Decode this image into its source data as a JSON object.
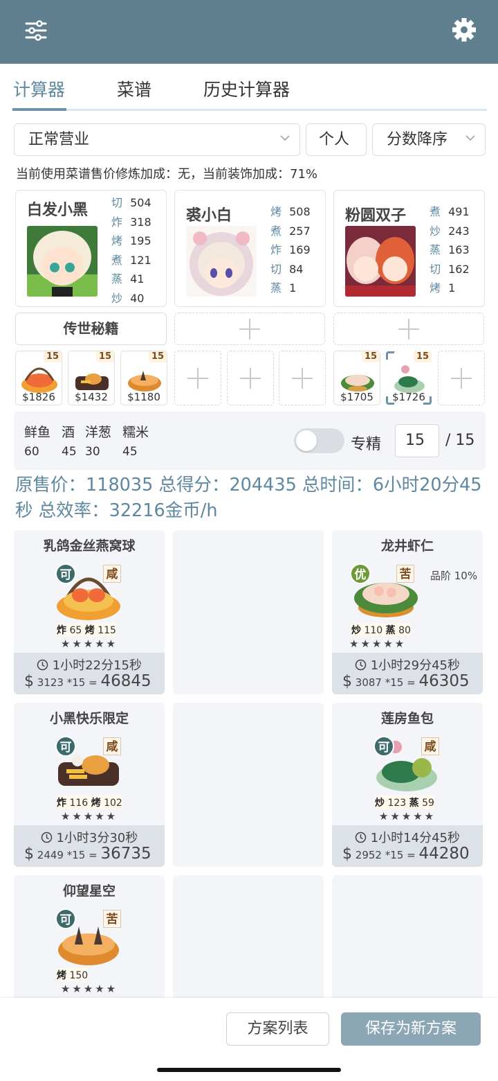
{
  "colors": {
    "header": "#5f7f8f",
    "accent": "#5d88a0",
    "primary_button": "#8ba6b5"
  },
  "toolbar": {
    "filter_icon": "sliders-icon",
    "settings_icon": "gear-icon"
  },
  "tabs": [
    {
      "label": "计算器",
      "active": true
    },
    {
      "label": "菜谱",
      "active": false
    },
    {
      "label": "历史计算器",
      "active": false
    }
  ],
  "filters": {
    "mode": "正常营业",
    "scope": "个人",
    "sort": "分数降序"
  },
  "info_line": "当前使用菜谱售价修炼加成：无，当前装饰加成：71%",
  "chefs": [
    {
      "name": "白发小黑",
      "skills": [
        {
          "k": "切",
          "v": "504"
        },
        {
          "k": "炸",
          "v": "318"
        },
        {
          "k": "烤",
          "v": "195"
        },
        {
          "k": "煮",
          "v": "121"
        },
        {
          "k": "蒸",
          "v": "41"
        },
        {
          "k": "炒",
          "v": "40"
        }
      ]
    },
    {
      "name": "裘小白",
      "skills": [
        {
          "k": "烤",
          "v": "508"
        },
        {
          "k": "煮",
          "v": "257"
        },
        {
          "k": "炸",
          "v": "169"
        },
        {
          "k": "切",
          "v": "84"
        },
        {
          "k": "蒸",
          "v": "1"
        }
      ]
    },
    {
      "name": "粉圆双子",
      "skills": [
        {
          "k": "煮",
          "v": "491"
        },
        {
          "k": "炒",
          "v": "243"
        },
        {
          "k": "蒸",
          "v": "163"
        },
        {
          "k": "切",
          "v": "162"
        },
        {
          "k": "烤",
          "v": "1"
        }
      ]
    }
  ],
  "secret_book": "传世秘籍",
  "dish_slots": [
    {
      "price": "$1826",
      "count": "15"
    },
    {
      "price": "$1432",
      "count": "15"
    },
    {
      "price": "$1180",
      "count": "15"
    },
    {
      "price": "$1705",
      "count": "15"
    },
    {
      "price": "$1726",
      "count": "15"
    }
  ],
  "materials": [
    {
      "name": "鲜鱼",
      "value": "60"
    },
    {
      "name": "酒",
      "value": "45"
    },
    {
      "name": "洋葱",
      "value": "30"
    },
    {
      "name": "糯米",
      "value": "45"
    }
  ],
  "mastery": {
    "label": "专精",
    "value": "15",
    "max": "/ 15",
    "enabled": false
  },
  "summary": "原售价：118035 总得分：204435 总时间：6小时20分45秒 总效率：32216金币/h",
  "cards": [
    {
      "title": "乳鸽金丝燕窝球",
      "grade": "可",
      "taste": "咸",
      "req1": "炸",
      "req1v": "65",
      "req2": "烤",
      "req2v": "115",
      "stars": "★★★★★",
      "time": "1小时22分15秒",
      "unit": "3123",
      "mult": "*15",
      "total": "46845"
    },
    {
      "title": "龙井虾仁",
      "grade": "优",
      "taste": "苦",
      "note": "品阶 10%",
      "req1": "炒",
      "req1v": "110",
      "req2": "蒸",
      "req2v": "80",
      "stars": "★★★★★",
      "time": "1小时29分45秒",
      "unit": "3087",
      "mult": "*15",
      "total": "46305"
    },
    {
      "title": "小黑快乐限定",
      "grade": "可",
      "taste": "咸",
      "req1": "炸",
      "req1v": "116",
      "req2": "烤",
      "req2v": "102",
      "stars": "★★★★★",
      "time": "1小时3分30秒",
      "unit": "2449",
      "mult": "*15",
      "total": "36735"
    },
    {
      "title": "莲房鱼包",
      "grade": "可",
      "taste": "咸",
      "req1": "炒",
      "req1v": "123",
      "req2": "蒸",
      "req2v": "59",
      "stars": "★★★★★",
      "time": "1小时14分45秒",
      "unit": "2952",
      "mult": "*15",
      "total": "44280"
    },
    {
      "title": "仰望星空",
      "grade": "可",
      "taste": "苦",
      "req1": "烤",
      "req1v": "150",
      "stars": "★★★★★"
    }
  ],
  "buttons": {
    "plan_list": "方案列表",
    "save_new": "保存为新方案"
  }
}
